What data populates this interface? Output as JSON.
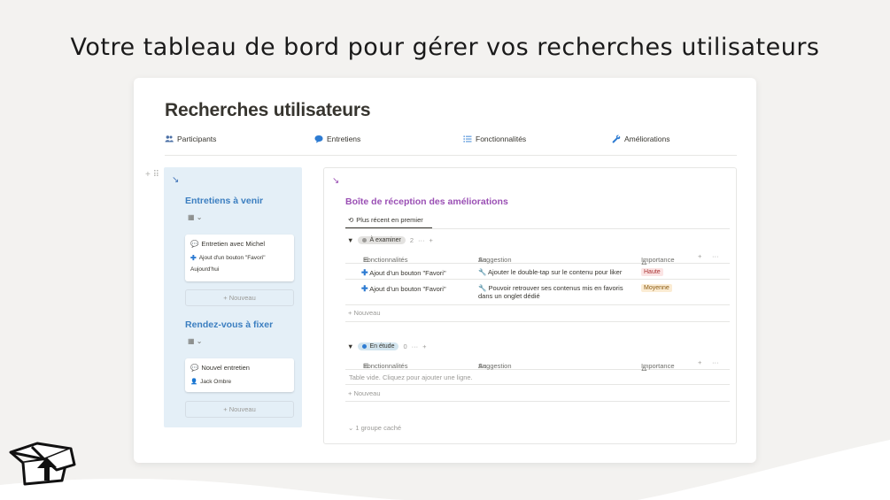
{
  "headline": "Votre tableau de bord pour gérer vos recherches utilisateurs",
  "page": {
    "title": "Recherches utilisateurs",
    "nav": [
      {
        "label": "Participants",
        "icon": "people-icon"
      },
      {
        "label": "Entretiens",
        "icon": "chat-bubble-icon"
      },
      {
        "label": "Fonctionnalités",
        "icon": "list-icon"
      },
      {
        "label": "Améliorations",
        "icon": "wrench-icon"
      }
    ]
  },
  "left": {
    "section1": {
      "title": "Entretiens à venir",
      "card": {
        "title": "Entretien avec Michel",
        "relation": "Ajout d'un bouton \"Favori\"",
        "date": "Aujourd'hui"
      },
      "new_label": "+ Nouveau"
    },
    "section2": {
      "title": "Rendez-vous à fixer",
      "card": {
        "title": "Nouvel entretien",
        "person": "Jack Ombre"
      },
      "new_label": "+ Nouveau"
    }
  },
  "right": {
    "title": "Boîte de réception des améliorations",
    "view_tab": "Plus récent en premier",
    "columns": {
      "c1": "Fonctionnalités",
      "c2": "Suggestion",
      "c2_prefix": "Aa",
      "c3": "Importance"
    },
    "group1": {
      "label": "À examiner",
      "count": "2",
      "rows": [
        {
          "feature": "Ajout d'un bouton \"Favori\"",
          "suggestion": "Ajouter le double-tap sur le contenu pour liker",
          "suggestion2": "",
          "importance": "Haute"
        },
        {
          "feature": "Ajout d'un bouton \"Favori\"",
          "suggestion": "Pouvoir retrouver ses contenus mis en favoris",
          "suggestion2": "dans un onglet dédié",
          "importance": "Moyenne"
        }
      ],
      "new_label": "+ Nouveau"
    },
    "group2": {
      "label": "En étude",
      "count": "0",
      "empty": "Table vide. Cliquez pour ajouter une ligne.",
      "new_label": "+ Nouveau"
    },
    "hidden": "1 groupe caché"
  },
  "colors": {
    "left_panel_bg": "#e4eff7",
    "section_title": "#3b7ec0",
    "inbox_title": "#9a4fb4",
    "tag_haute_bg": "#fbe4e4",
    "tag_moyenne_bg": "#fbecd3"
  }
}
